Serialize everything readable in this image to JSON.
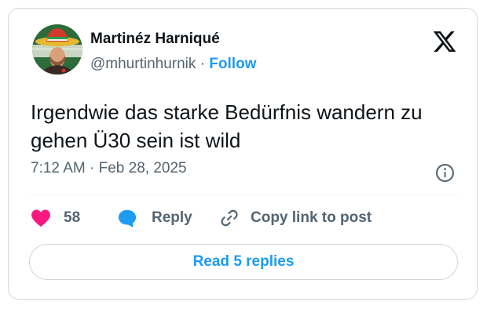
{
  "author": {
    "name": "Martinéz Harniqué",
    "handle": "@mhurtinhurnik",
    "separator": "·",
    "follow_label": "Follow"
  },
  "tweet": {
    "text": "Irgendwie das starke Bedürfnis wandern zu gehen Ü30 sein ist wild",
    "time": "7:12 AM",
    "date_separator": "·",
    "date": "Feb 28, 2025"
  },
  "actions": {
    "like_count": "58",
    "reply_label": "Reply",
    "copy_label": "Copy link to post"
  },
  "read_replies_label": "Read 5 replies",
  "icons": {
    "platform": "x-logo-icon",
    "info": "info-icon",
    "like": "heart-icon",
    "reply": "speech-bubble-icon",
    "copy": "link-icon"
  },
  "colors": {
    "accent": "#1d9bf0",
    "like": "#f91880",
    "text": "#0f1419",
    "secondary": "#536471",
    "border": "#cfd9de"
  }
}
